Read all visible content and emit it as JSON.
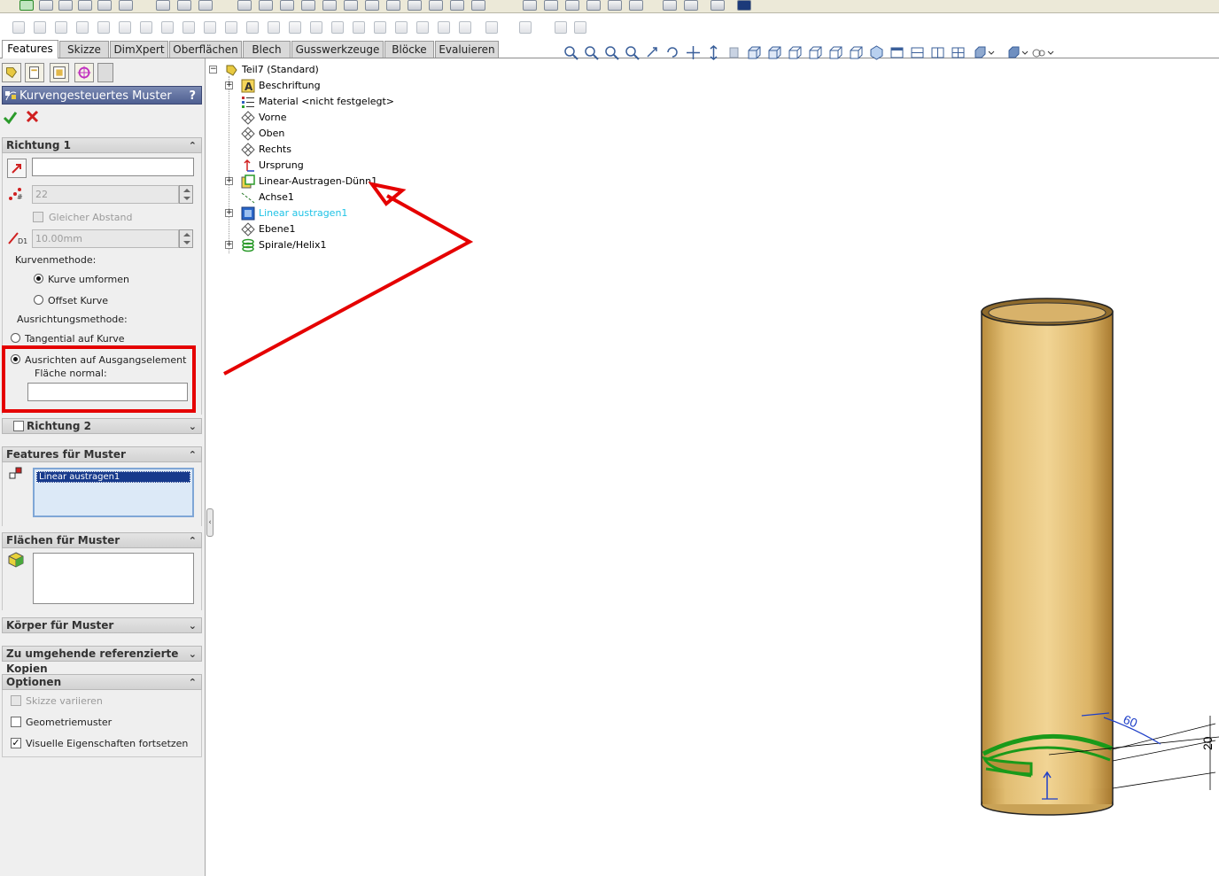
{
  "command_tabs": [
    "Features",
    "Skizze",
    "DimXpert",
    "Oberflächen",
    "Blech",
    "Gusswerkzeuge",
    "Blöcke",
    "Evaluieren"
  ],
  "active_command_tab": "Features",
  "property_manager": {
    "title": "Kurvengesteuertes Muster",
    "help": "?",
    "ok_icon": "check-icon",
    "cancel_icon": "close-icon",
    "direction1": {
      "header": "Richtung 1",
      "direction_value": "",
      "instances_value": "22",
      "equal_spacing_label": "Gleicher Abstand",
      "spacing_value": "10.00mm",
      "curve_method_label": "Kurvenmethode:",
      "curve_methods": [
        "Kurve umformen",
        "Offset Kurve"
      ],
      "curve_method_selected": "Kurve umformen",
      "alignment_method_label": "Ausrichtungsmethode:",
      "alignment_methods": [
        "Tangential auf Kurve",
        "Ausrichten auf Ausgangselement"
      ],
      "alignment_selected": "Ausrichten auf Ausgangselement",
      "face_normal_label": "Fläche normal:",
      "face_normal_value": ""
    },
    "direction2": {
      "header": "Richtung 2",
      "checked": false
    },
    "features_to_pattern": {
      "header": "Features für Muster",
      "items": [
        "Linear austragen1"
      ]
    },
    "faces_to_pattern": {
      "header": "Flächen für Muster"
    },
    "bodies_to_pattern": {
      "header": "Körper für Muster"
    },
    "skip_instances": {
      "header": "Zu umgehende referenzierte Kopien"
    },
    "options": {
      "header": "Optionen",
      "items": [
        {
          "label": "Skizze variieren",
          "checked": false,
          "enabled": false
        },
        {
          "label": "Geometriemuster",
          "checked": false,
          "enabled": true
        },
        {
          "label": "Visuelle Eigenschaften fortsetzen",
          "checked": true,
          "enabled": true
        }
      ]
    }
  },
  "feature_tree": {
    "root": "Teil7  (Standard)",
    "items": [
      {
        "label": "Beschriftung",
        "icon": "annotation-icon",
        "expandable": true
      },
      {
        "label": "Material <nicht festgelegt>",
        "icon": "material-icon",
        "expandable": false
      },
      {
        "label": "Vorne",
        "icon": "plane-icon",
        "expandable": false
      },
      {
        "label": "Oben",
        "icon": "plane-icon",
        "expandable": false
      },
      {
        "label": "Rechts",
        "icon": "plane-icon",
        "expandable": false
      },
      {
        "label": "Ursprung",
        "icon": "origin-icon",
        "expandable": false
      },
      {
        "label": "Linear-Austragen-Dünn1",
        "icon": "extrude-thin-icon",
        "expandable": true
      },
      {
        "label": "Achse1",
        "icon": "axis-icon",
        "expandable": false
      },
      {
        "label": "Linear austragen1",
        "icon": "extrude-icon",
        "expandable": true,
        "highlighted": true
      },
      {
        "label": "Ebene1",
        "icon": "plane-icon",
        "expandable": false
      },
      {
        "label": "Spirale/Helix1",
        "icon": "helix-icon",
        "expandable": true
      }
    ]
  },
  "viewport": {
    "dimension_angle": "60",
    "dimension_height": "20",
    "part_color": "#e8c27a",
    "highlight_color": "#1a9a1a",
    "annotation_color": "#e50000"
  }
}
